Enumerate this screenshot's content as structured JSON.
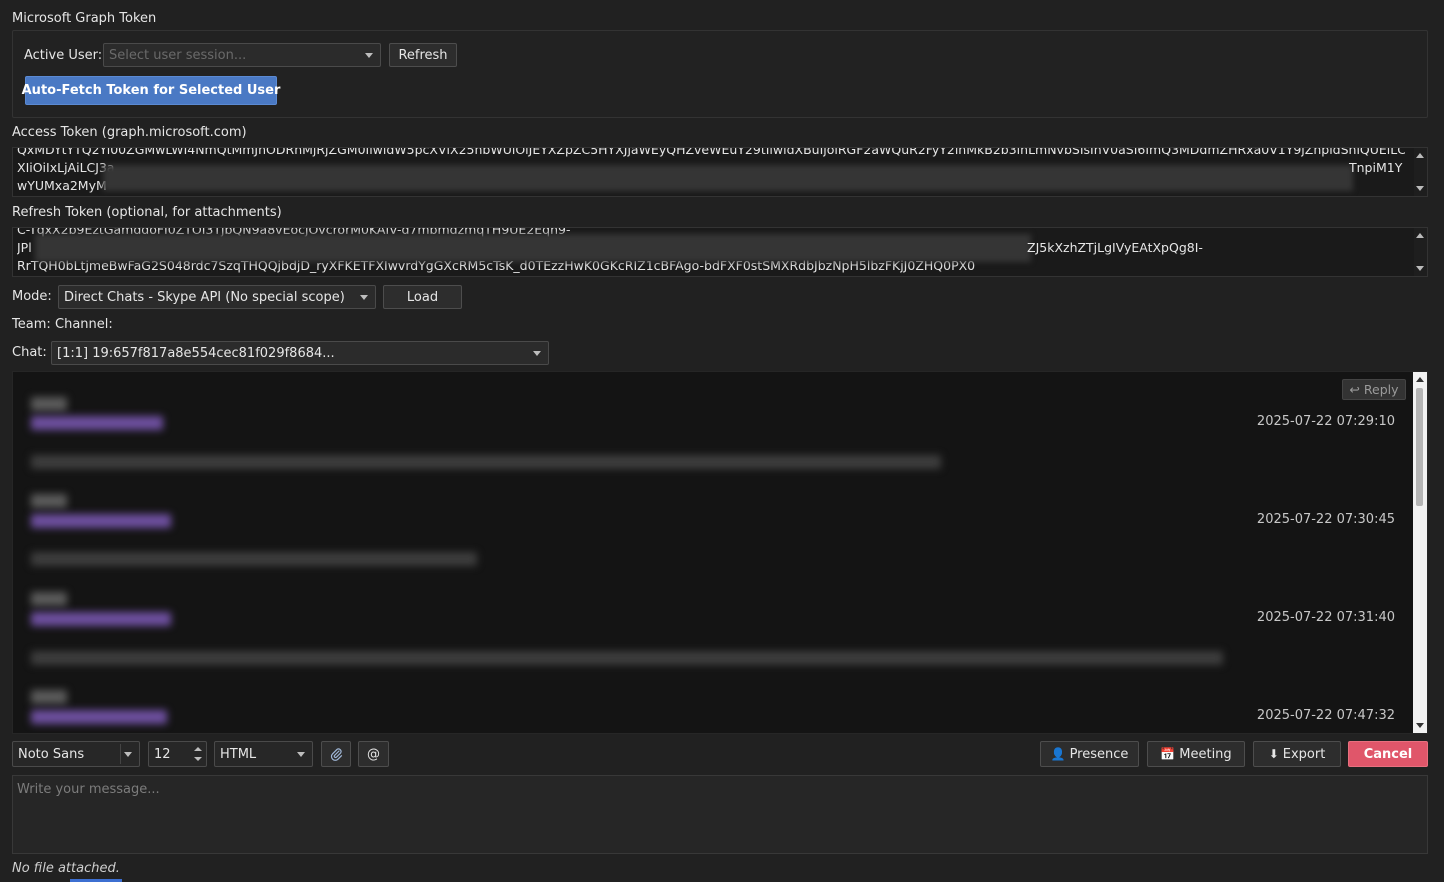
{
  "token_group": {
    "title": "Microsoft Graph Token",
    "active_user_label": "Active User:",
    "active_user_placeholder": "Select user session...",
    "refresh_label": "Refresh",
    "auto_fetch_label": "Auto-Fetch Token for Selected User"
  },
  "access_token": {
    "label": "Access Token (graph.microsoft.com)",
    "lines": [
      "QxMDYtYTQ2Yi00ZGMwLWI4NmQtMmJhODRhMjRjZGM0IiwidW5pcXVlX25hbWUiOiJEYXZpZC5HYXJjaWEyQHZveWEuY29tIiwidXBuIjoiRGF2aWQuR2FyY2lhMkB2b3lhLmNvbSIsInV0aSI6ImQ3MDdmZHRxa0V1Y9jZnpldShiQUEiLCJ2ZXIiOiIxLjAiLCJ3a",
      "XIiOiIxLjAiLCJ3a",
      "wYUMxa2MyM"
    ],
    "line2_tail": "TnpiM1Y"
  },
  "refresh_token": {
    "label": "Refresh Token (optional, for attachments)",
    "lines": [
      "C-TqxX2b9EztGamddoFI0ZTOI3TjbQN9a8vEocjOvcrorM0KAIV-d7mbmdzmqTH9UE2Eqh9-",
      "JPl",
      "RrTQH0bLtjmeBwFaG2S048rdc7SzqTHQQjbdjD_ryXFKETFXIwvrdYgGXcRM5cTsK_d0TEzzHwK0GKcRIZ1cBFAgo-bdFXF0stSMXRdbJbzNpH5lbzFKjJ0ZHQ0PX0"
    ],
    "line2_tail": "ZJ5kXzhZTjLgIVyEAtXpQg8I-"
  },
  "mode": {
    "label": "Mode:",
    "value": "Direct Chats - Skype API (No special scope)",
    "load_label": "Load"
  },
  "team_label": "Team:",
  "channel_label": "Channel:",
  "chat": {
    "label": "Chat:",
    "value": "[1:1] 19:657f817a8e554cec81f029f8684..."
  },
  "messages": {
    "reply_label": "↩ Reply",
    "timestamps": [
      "2025-07-22 07:29:10",
      "2025-07-22 07:30:45",
      "2025-07-22 07:31:40",
      "2025-07-22 07:47:32"
    ]
  },
  "toolbar": {
    "font_value": "Noto Sans",
    "size_value": "12",
    "format_value": "HTML",
    "attach_icon": "paperclip-icon",
    "mention_label": "@",
    "presence_label": "Presence",
    "meeting_label": "Meeting",
    "export_label": "Export",
    "cancel_label": "Cancel"
  },
  "compose": {
    "placeholder": "Write your message..."
  },
  "status": {
    "attachment_text": "No file attached."
  },
  "colors": {
    "background": "#212121",
    "primary_button": "#4a79c4",
    "cancel_button": "#e0566a",
    "sender_accent": "#6d4f9e"
  }
}
